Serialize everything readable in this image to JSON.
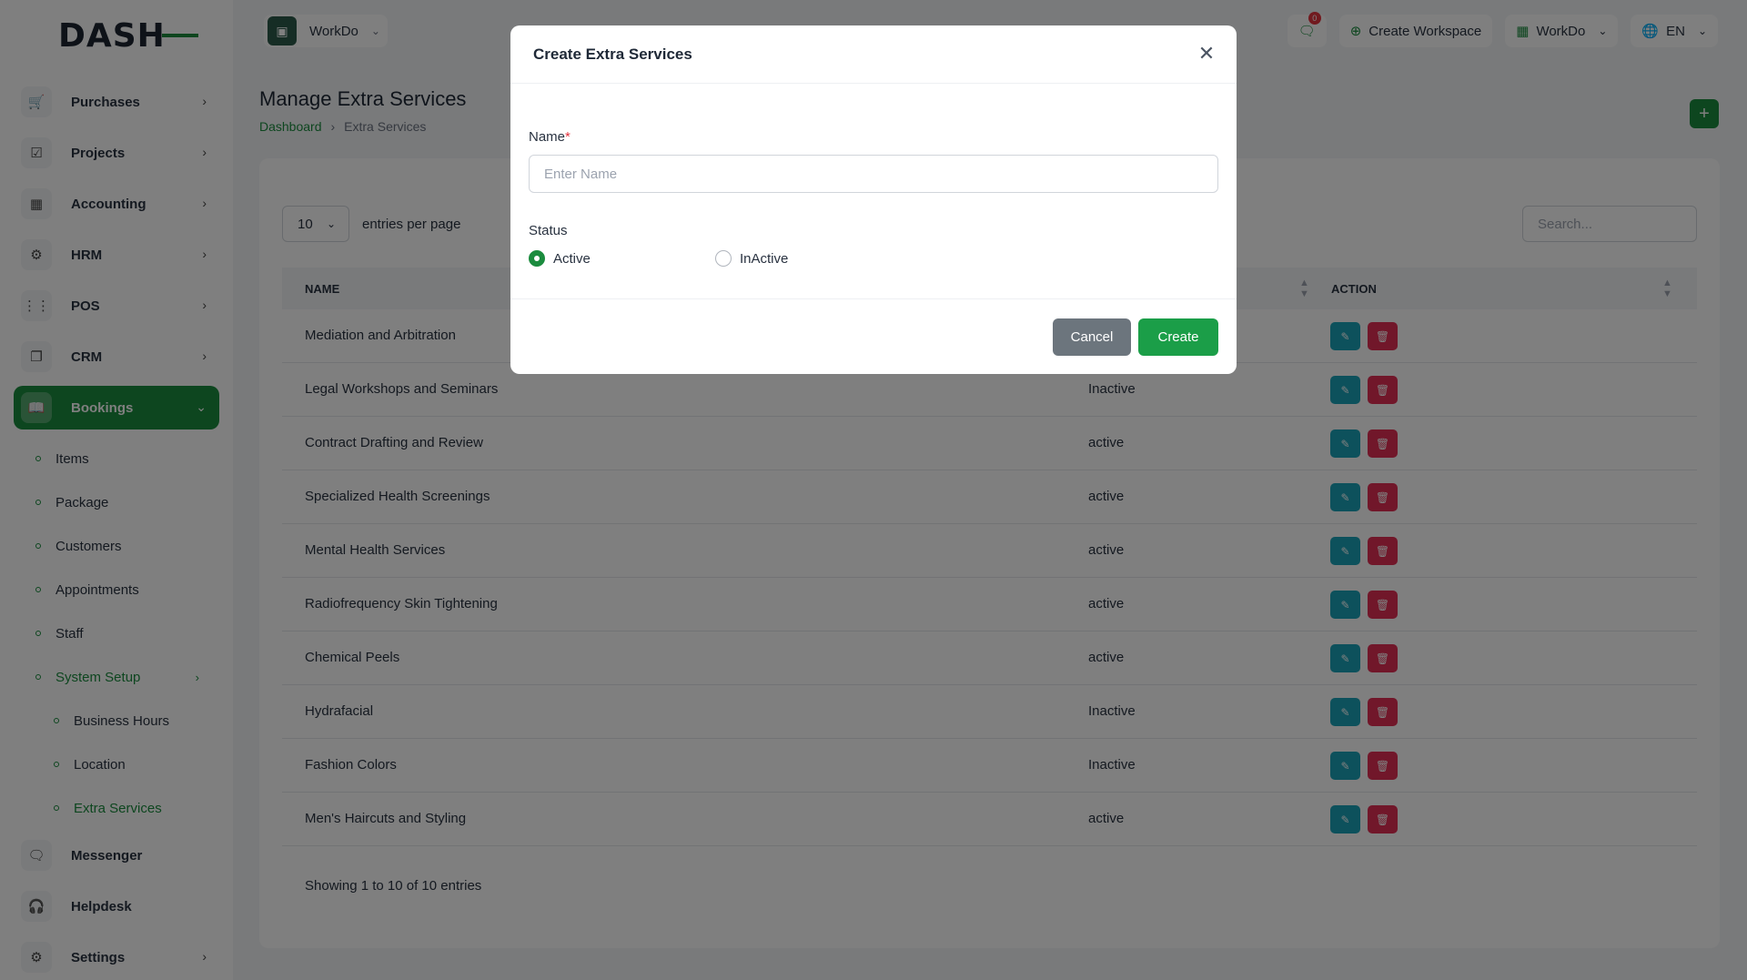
{
  "brand": {
    "logo_text": "DASH"
  },
  "topbar": {
    "workspace_label": "WorkDo",
    "messages_badge": "0",
    "create_workspace": "Create Workspace",
    "workdo_menu": "WorkDo",
    "language": "EN"
  },
  "sidebar": {
    "items": [
      {
        "label": "Purchases",
        "icon": "cart-icon"
      },
      {
        "label": "Projects",
        "icon": "checkbox-icon"
      },
      {
        "label": "Accounting",
        "icon": "grid-icon"
      },
      {
        "label": "HRM",
        "icon": "gear-icon"
      },
      {
        "label": "POS",
        "icon": "dots-grid-icon"
      },
      {
        "label": "CRM",
        "icon": "layers-icon"
      },
      {
        "label": "Bookings",
        "icon": "book-icon"
      }
    ],
    "sub_items": [
      "Items",
      "Package",
      "Customers",
      "Appointments",
      "Staff",
      "System Setup"
    ],
    "sub_sub_items": [
      "Business Hours",
      "Location",
      "Extra Services"
    ],
    "bottom_items": [
      {
        "label": "Messenger",
        "icon": "chat-icon"
      },
      {
        "label": "Helpdesk",
        "icon": "headset-icon"
      },
      {
        "label": "Settings",
        "icon": "gear-icon"
      }
    ]
  },
  "page": {
    "title": "Manage Extra Services",
    "breadcrumb_home": "Dashboard",
    "breadcrumb_current": "Extra Services"
  },
  "table": {
    "entries_value": "10",
    "entries_label": "entries per page",
    "search_placeholder": "Search...",
    "headers": {
      "name": "NAME",
      "action": "ACTION"
    },
    "rows": [
      {
        "name": "Mediation and Arbitration",
        "status": ""
      },
      {
        "name": "Legal Workshops and Seminars",
        "status": "Inactive"
      },
      {
        "name": "Contract Drafting and Review",
        "status": "active"
      },
      {
        "name": "Specialized Health Screenings",
        "status": "active"
      },
      {
        "name": "Mental Health Services",
        "status": "active"
      },
      {
        "name": "Radiofrequency Skin Tightening",
        "status": "active"
      },
      {
        "name": "Chemical Peels",
        "status": "active"
      },
      {
        "name": "Hydrafacial",
        "status": "Inactive"
      },
      {
        "name": "Fashion Colors",
        "status": "Inactive"
      },
      {
        "name": "Men's Haircuts and Styling",
        "status": "active"
      }
    ],
    "showing": "Showing 1 to 10 of 10 entries"
  },
  "modal": {
    "title": "Create Extra Services",
    "name_label": "Name",
    "name_required": "*",
    "name_placeholder": "Enter Name",
    "status_label": "Status",
    "status_active": "Active",
    "status_inactive": "InActive",
    "cancel": "Cancel",
    "create": "Create"
  }
}
